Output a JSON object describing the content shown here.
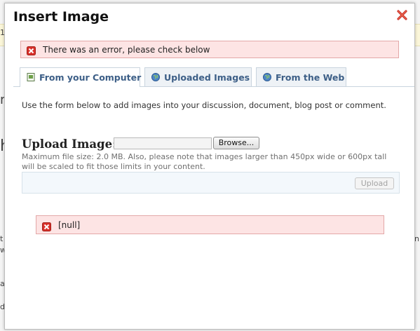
{
  "dialog": {
    "title": "Insert Image",
    "error_top": "There was an error, please check below",
    "tabs": [
      {
        "label": "From your Computer",
        "active": true
      },
      {
        "label": "Uploaded Images",
        "active": false
      },
      {
        "label": "From the Web",
        "active": false
      }
    ],
    "intro": "Use the form below to add images into your discussion, document, blog post or comment.",
    "upload": {
      "label": "Upload Image:",
      "file_value": "",
      "browse_label": "Browse...",
      "note": "Maximum file size: 2.0 MB. Also, please note that images larger than 450px wide or 600px tall will be scaled to fit those limits in your content.",
      "upload_label": "Upload"
    },
    "error_bottom": "[null]"
  },
  "background": {
    "fragments": [
      "1",
      "ro",
      "h",
      "t",
      "n",
      "w",
      "ar",
      "d"
    ]
  },
  "colors": {
    "error_bg": "#fde4e4",
    "error_border": "#e3a8a8",
    "tab_text": "#3d5f87",
    "error_icon": "#d9302a"
  },
  "icons": {
    "close": "close-x-icon",
    "error": "error-x-icon",
    "tab_computer": "image-file-icon",
    "tab_uploaded": "globe-icon",
    "tab_web": "globe-icon"
  }
}
